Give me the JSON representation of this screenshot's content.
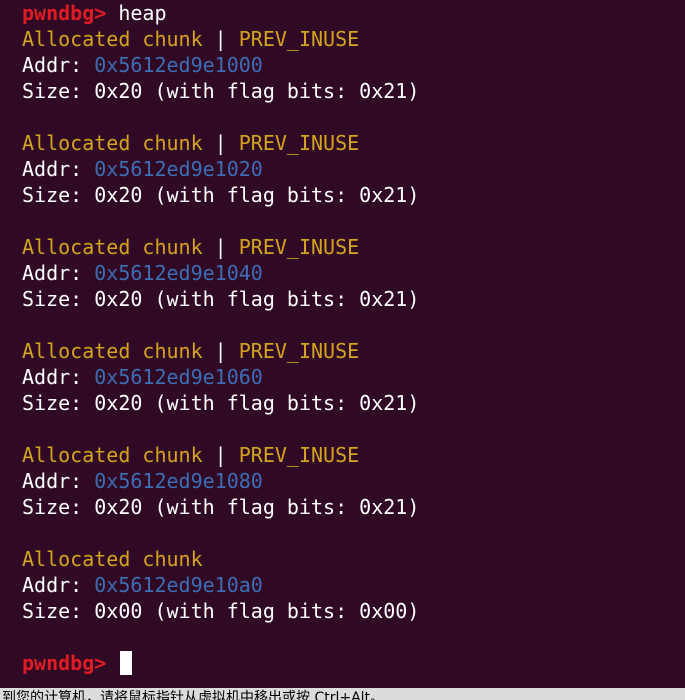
{
  "terminal": {
    "prompt": "pwndbg>",
    "command": "heap",
    "chunks": [
      {
        "status": "Allocated chunk",
        "flag_sep": " | ",
        "flag": "PREV_INUSE",
        "addr_label": "Addr: ",
        "addr": "0x5612ed9e1000",
        "size_line": "Size: 0x20 (with flag bits: 0x21)"
      },
      {
        "status": "Allocated chunk",
        "flag_sep": " | ",
        "flag": "PREV_INUSE",
        "addr_label": "Addr: ",
        "addr": "0x5612ed9e1020",
        "size_line": "Size: 0x20 (with flag bits: 0x21)"
      },
      {
        "status": "Allocated chunk",
        "flag_sep": " | ",
        "flag": "PREV_INUSE",
        "addr_label": "Addr: ",
        "addr": "0x5612ed9e1040",
        "size_line": "Size: 0x20 (with flag bits: 0x21)"
      },
      {
        "status": "Allocated chunk",
        "flag_sep": " | ",
        "flag": "PREV_INUSE",
        "addr_label": "Addr: ",
        "addr": "0x5612ed9e1060",
        "size_line": "Size: 0x20 (with flag bits: 0x21)"
      },
      {
        "status": "Allocated chunk",
        "flag_sep": " | ",
        "flag": "PREV_INUSE",
        "addr_label": "Addr: ",
        "addr": "0x5612ed9e1080",
        "size_line": "Size: 0x20 (with flag bits: 0x21)"
      },
      {
        "status": "Allocated chunk",
        "flag_sep": "",
        "flag": "",
        "addr_label": "Addr: ",
        "addr": "0x5612ed9e10a0",
        "size_line": "Size: 0x00 (with flag bits: 0x00)"
      }
    ]
  },
  "statusbar": {
    "text": "到您的计算机，请将鼠标指针从虚拟机中移出或按 Ctrl+Alt。"
  },
  "colors": {
    "background": "#300a24",
    "prompt": "#e01b24",
    "chunk_header": "#d4a31f",
    "address": "#3d6db5",
    "text": "#ffffff"
  }
}
